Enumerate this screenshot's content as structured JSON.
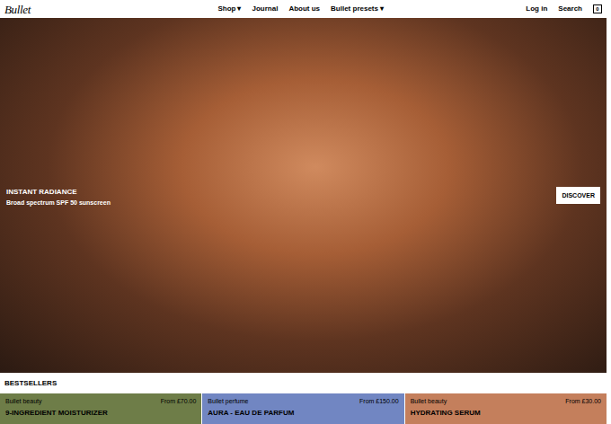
{
  "logo": "Bullet",
  "nav": [
    {
      "label": "Shop",
      "caret": "▾"
    },
    {
      "label": "Journal"
    },
    {
      "label": "About us"
    },
    {
      "label": "Bullet presets",
      "caret": "▾"
    }
  ],
  "utility": [
    "Log in",
    "Search"
  ],
  "cart": {
    "count": "0"
  },
  "hero": {
    "title": "INSTANT RADIANCE",
    "subtitle": "Broad spectrum SPF 50 sunscreen",
    "button": "DISCOVER"
  },
  "section_title": "BESTSELLERS",
  "products": [
    {
      "brand": "Bullet beauty",
      "price": "From £70.00",
      "name": "9-INGREDIENT MOISTURIZER",
      "color": "#6e7d48"
    },
    {
      "brand": "Bullet perfume",
      "price": "From £150.00",
      "name": "AURA - EAU DE PARFUM",
      "color": "#7186c2"
    },
    {
      "brand": "Bullet beauty",
      "price": "From £30.00",
      "name": "HYDRATING SERUM",
      "color": "#c47f5c"
    }
  ]
}
